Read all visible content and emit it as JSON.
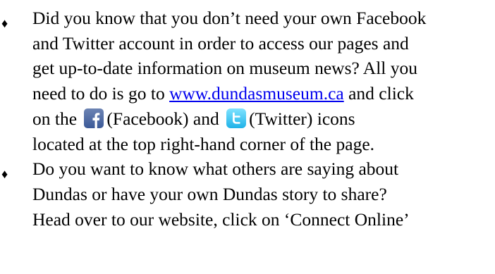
{
  "bullets": [
    {
      "marker": "♦",
      "lines": {
        "l1": "Did you know that you don’t need  your own Facebook",
        "l2": "and Twitter account in order to access our pages and",
        "l3": "get up-to-date information on museum news? All you",
        "l4_before": "need to do is go to ",
        "l4_link": "www.dundasmuseum.ca",
        "l4_after": " and click",
        "l5_before": "on the ",
        "l5_fb_caption": "(Facebook) and ",
        "l5_tw_caption": "(Twitter) icons",
        "l6": "located at the top right-hand corner of the page."
      }
    },
    {
      "marker": "♦",
      "lines": {
        "l1": "Do you want to know what others are saying about",
        "l2": "Dundas or have your own Dundas story to share?",
        "l3": "Head over to our website, click on ‘Connect Online’"
      }
    }
  ],
  "icons": {
    "facebook": "facebook-icon",
    "twitter": "twitter-icon"
  },
  "colors": {
    "link": "#0000ee",
    "facebook_blue": "#3b5998",
    "twitter_blue": "#33ccff"
  }
}
